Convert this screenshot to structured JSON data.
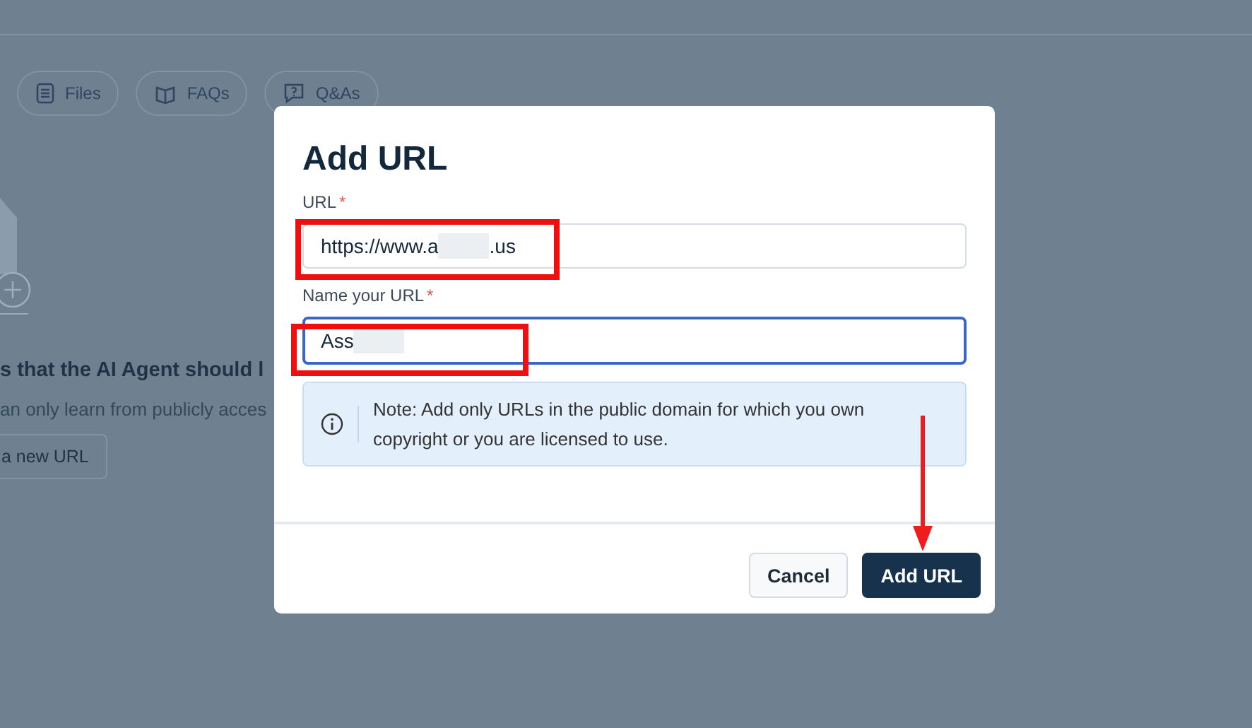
{
  "page": {
    "tabs": [
      {
        "label": "Files",
        "kind": "file"
      },
      {
        "label": "FAQs",
        "kind": "book"
      },
      {
        "label": "Q&As",
        "kind": "chat"
      }
    ],
    "heading": "s that the AI Agent should l",
    "subtext": "an only learn from publicly acces",
    "add_button": "a new URL"
  },
  "dialog": {
    "title": "Add URL",
    "fields": [
      {
        "label": "URL",
        "required_mark": "*",
        "value_start": "https://www.a",
        "value_end": ".us",
        "focused": false
      },
      {
        "label": "Name your URL",
        "required_mark": "*",
        "value_start": "Ass",
        "focused": true
      }
    ],
    "note": "Note: Add only URLs in the public domain for which you own copyright or you are licensed to use.",
    "buttons": [
      {
        "label": "Cancel",
        "kind": "secondary"
      },
      {
        "label": "Add URL",
        "kind": "primary"
      }
    ]
  }
}
